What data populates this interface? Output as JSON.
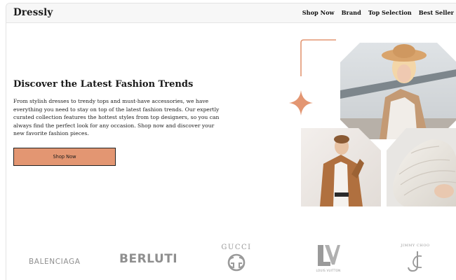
{
  "brand": {
    "name": "Dressly"
  },
  "nav": {
    "items": [
      {
        "label": "Shop Now"
      },
      {
        "label": "Brand"
      },
      {
        "label": "Top Selection"
      },
      {
        "label": "Best Seller"
      }
    ]
  },
  "hero": {
    "title": "Discover the Latest Fashion Trends",
    "body": "From stylish dresses to trendy tops and must-have accessories, we have everything you need to stay on top of the latest fashion trends. Our expertly curated collection features the hottest styles from top designers, so you can always find the perfect look for any occasion. Shop now and discover your new favorite fashion pieces.",
    "cta_label": "Shop Now"
  },
  "colors": {
    "accent": "#e39672",
    "nav_bg": "#f7f7f7",
    "logo_gray": "#999999"
  },
  "brands": {
    "balenciaga": "BALENCIAGA",
    "berluti": "BERLUTI",
    "gucci": "GUCCI",
    "louis_vuitton": "LOUIS VUITTON",
    "jimmy_choo": "JIMMY CHOO"
  }
}
